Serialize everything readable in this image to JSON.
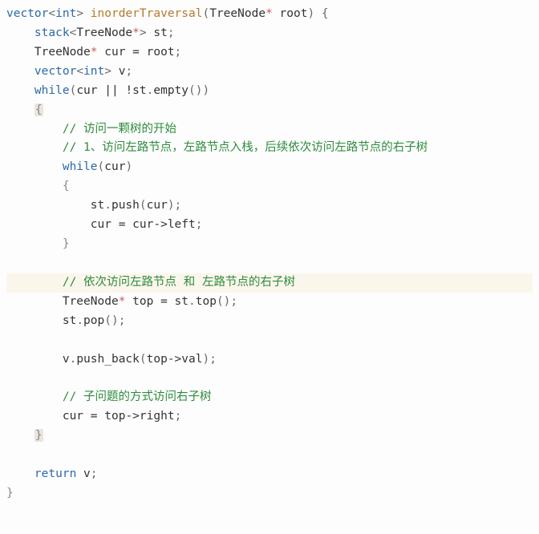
{
  "code": {
    "lines": [
      {
        "indent": 0,
        "hl": false,
        "tokens": [
          [
            "type",
            "vector"
          ],
          [
            "punc",
            "<"
          ],
          [
            "type",
            "int"
          ],
          [
            "punc",
            "> "
          ],
          [
            "func",
            "inorderTraversal"
          ],
          [
            "punc",
            "("
          ],
          [
            "class",
            "TreeNode"
          ],
          [
            "star",
            "* "
          ],
          [
            "ident",
            "root"
          ],
          [
            "punc",
            ") {"
          ]
        ]
      },
      {
        "indent": 4,
        "hl": false,
        "tokens": [
          [
            "type",
            "stack"
          ],
          [
            "punc",
            "<"
          ],
          [
            "class",
            "TreeNode"
          ],
          [
            "star",
            "*"
          ],
          [
            "punc",
            "> "
          ],
          [
            "ident",
            "st"
          ],
          [
            "punc",
            ";"
          ]
        ]
      },
      {
        "indent": 4,
        "hl": false,
        "tokens": [
          [
            "class",
            "TreeNode"
          ],
          [
            "star",
            "* "
          ],
          [
            "ident",
            "cur "
          ],
          [
            "op",
            "= "
          ],
          [
            "ident",
            "root"
          ],
          [
            "punc",
            ";"
          ]
        ]
      },
      {
        "indent": 4,
        "hl": false,
        "tokens": [
          [
            "type",
            "vector"
          ],
          [
            "punc",
            "<"
          ],
          [
            "type",
            "int"
          ],
          [
            "punc",
            "> "
          ],
          [
            "ident",
            "v"
          ],
          [
            "punc",
            ";"
          ]
        ]
      },
      {
        "indent": 4,
        "hl": false,
        "tokens": [
          [
            "key",
            "while"
          ],
          [
            "punc",
            "("
          ],
          [
            "ident",
            "cur "
          ],
          [
            "op",
            "|| "
          ],
          [
            "op",
            "!"
          ],
          [
            "ident",
            "st"
          ],
          [
            "punc",
            "."
          ],
          [
            "ident",
            "empty"
          ],
          [
            "punc",
            "())"
          ]
        ]
      },
      {
        "indent": 4,
        "hl": false,
        "tokens": [
          [
            "braceo",
            "{"
          ]
        ]
      },
      {
        "indent": 8,
        "hl": false,
        "tokens": [
          [
            "comment",
            "// 访问一颗树的开始"
          ]
        ]
      },
      {
        "indent": 8,
        "hl": false,
        "tokens": [
          [
            "comment",
            "// 1、访问左路节点，左路节点入栈，后续依次访问左路节点的右子树"
          ]
        ]
      },
      {
        "indent": 8,
        "hl": false,
        "tokens": [
          [
            "key",
            "while"
          ],
          [
            "punc",
            "("
          ],
          [
            "ident",
            "cur"
          ],
          [
            "punc",
            ")"
          ]
        ]
      },
      {
        "indent": 8,
        "hl": false,
        "tokens": [
          [
            "brace",
            "{"
          ]
        ]
      },
      {
        "indent": 12,
        "hl": false,
        "tokens": [
          [
            "ident",
            "st"
          ],
          [
            "punc",
            "."
          ],
          [
            "ident",
            "push"
          ],
          [
            "punc",
            "("
          ],
          [
            "ident",
            "cur"
          ],
          [
            "punc",
            ");"
          ]
        ]
      },
      {
        "indent": 12,
        "hl": false,
        "tokens": [
          [
            "ident",
            "cur "
          ],
          [
            "op",
            "= "
          ],
          [
            "ident",
            "cur"
          ],
          [
            "op",
            "->"
          ],
          [
            "ident",
            "left"
          ],
          [
            "punc",
            ";"
          ]
        ]
      },
      {
        "indent": 8,
        "hl": false,
        "tokens": [
          [
            "brace",
            "}"
          ]
        ]
      },
      {
        "indent": 0,
        "hl": true,
        "tokens": []
      },
      {
        "indent": 8,
        "hl": true,
        "tokens": [
          [
            "comment",
            "// 依次访问左路节点 和 左路节点的右子树"
          ]
        ]
      },
      {
        "indent": 8,
        "hl": false,
        "tokens": [
          [
            "class",
            "TreeNode"
          ],
          [
            "star",
            "* "
          ],
          [
            "ident",
            "top "
          ],
          [
            "op",
            "= "
          ],
          [
            "ident",
            "st"
          ],
          [
            "punc",
            "."
          ],
          [
            "ident",
            "top"
          ],
          [
            "punc",
            "();"
          ]
        ]
      },
      {
        "indent": 8,
        "hl": false,
        "tokens": [
          [
            "ident",
            "st"
          ],
          [
            "punc",
            "."
          ],
          [
            "ident",
            "pop"
          ],
          [
            "punc",
            "();"
          ]
        ]
      },
      {
        "indent": 0,
        "hl": false,
        "tokens": []
      },
      {
        "indent": 8,
        "hl": false,
        "tokens": [
          [
            "ident",
            "v"
          ],
          [
            "punc",
            "."
          ],
          [
            "ident",
            "push_back"
          ],
          [
            "punc",
            "("
          ],
          [
            "ident",
            "top"
          ],
          [
            "op",
            "->"
          ],
          [
            "ident",
            "val"
          ],
          [
            "punc",
            ");"
          ]
        ]
      },
      {
        "indent": 0,
        "hl": false,
        "tokens": []
      },
      {
        "indent": 8,
        "hl": false,
        "tokens": [
          [
            "comment",
            "// 子问题的方式访问右子树"
          ]
        ]
      },
      {
        "indent": 8,
        "hl": false,
        "tokens": [
          [
            "ident",
            "cur "
          ],
          [
            "op",
            "= "
          ],
          [
            "ident",
            "top"
          ],
          [
            "op",
            "->"
          ],
          [
            "ident",
            "right"
          ],
          [
            "punc",
            ";"
          ]
        ]
      },
      {
        "indent": 4,
        "hl": false,
        "tokens": [
          [
            "bracec",
            "}"
          ]
        ]
      },
      {
        "indent": 0,
        "hl": false,
        "tokens": []
      },
      {
        "indent": 4,
        "hl": false,
        "tokens": [
          [
            "key",
            "return"
          ],
          [
            "ident",
            " v"
          ],
          [
            "punc",
            ";"
          ]
        ]
      },
      {
        "indent": 0,
        "hl": false,
        "tokens": [
          [
            "brace",
            "}"
          ]
        ]
      }
    ]
  }
}
